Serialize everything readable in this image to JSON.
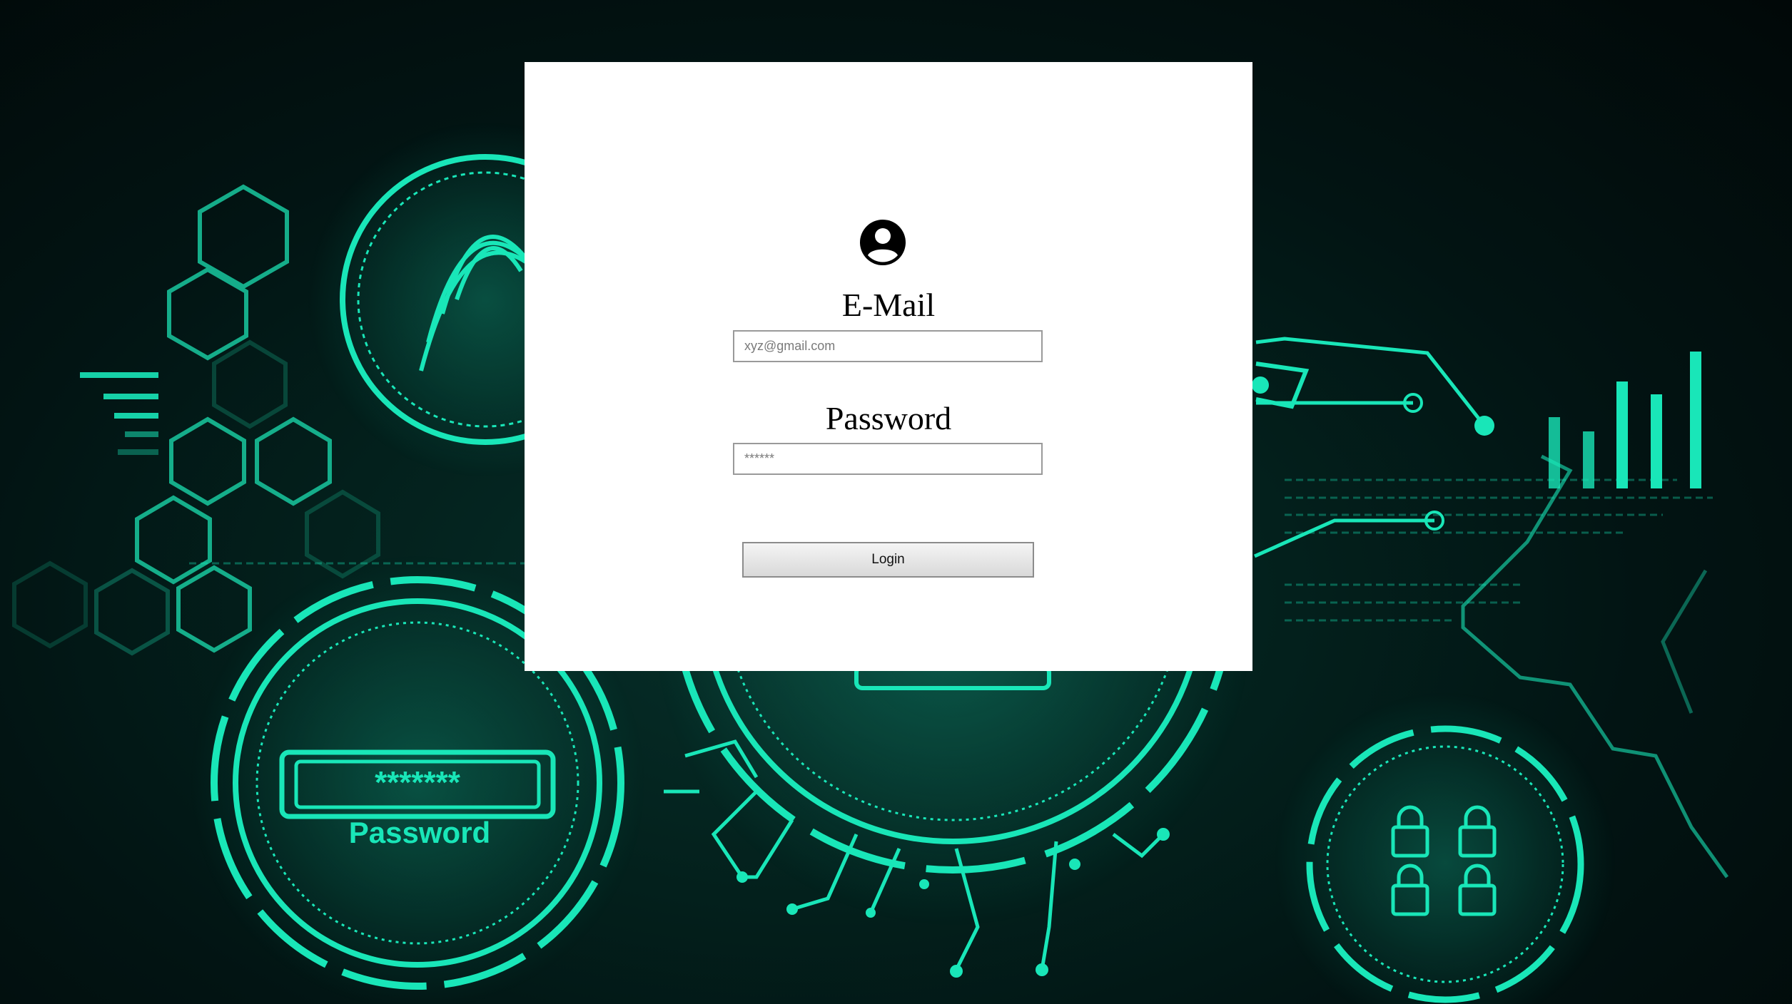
{
  "background": {
    "theme": "cyber-security illustration",
    "accent_color": "#19e6b8",
    "dark_color": "#021413",
    "illustration_text": "Password",
    "password_mask": "*******"
  },
  "login_form": {
    "user_icon": "user-circle-icon",
    "email_label": "E-Mail",
    "email_placeholder": "xyz@gmail.com",
    "email_value": "",
    "password_label": "Password",
    "password_placeholder": "******",
    "password_value": "",
    "login_button_label": "Login"
  }
}
